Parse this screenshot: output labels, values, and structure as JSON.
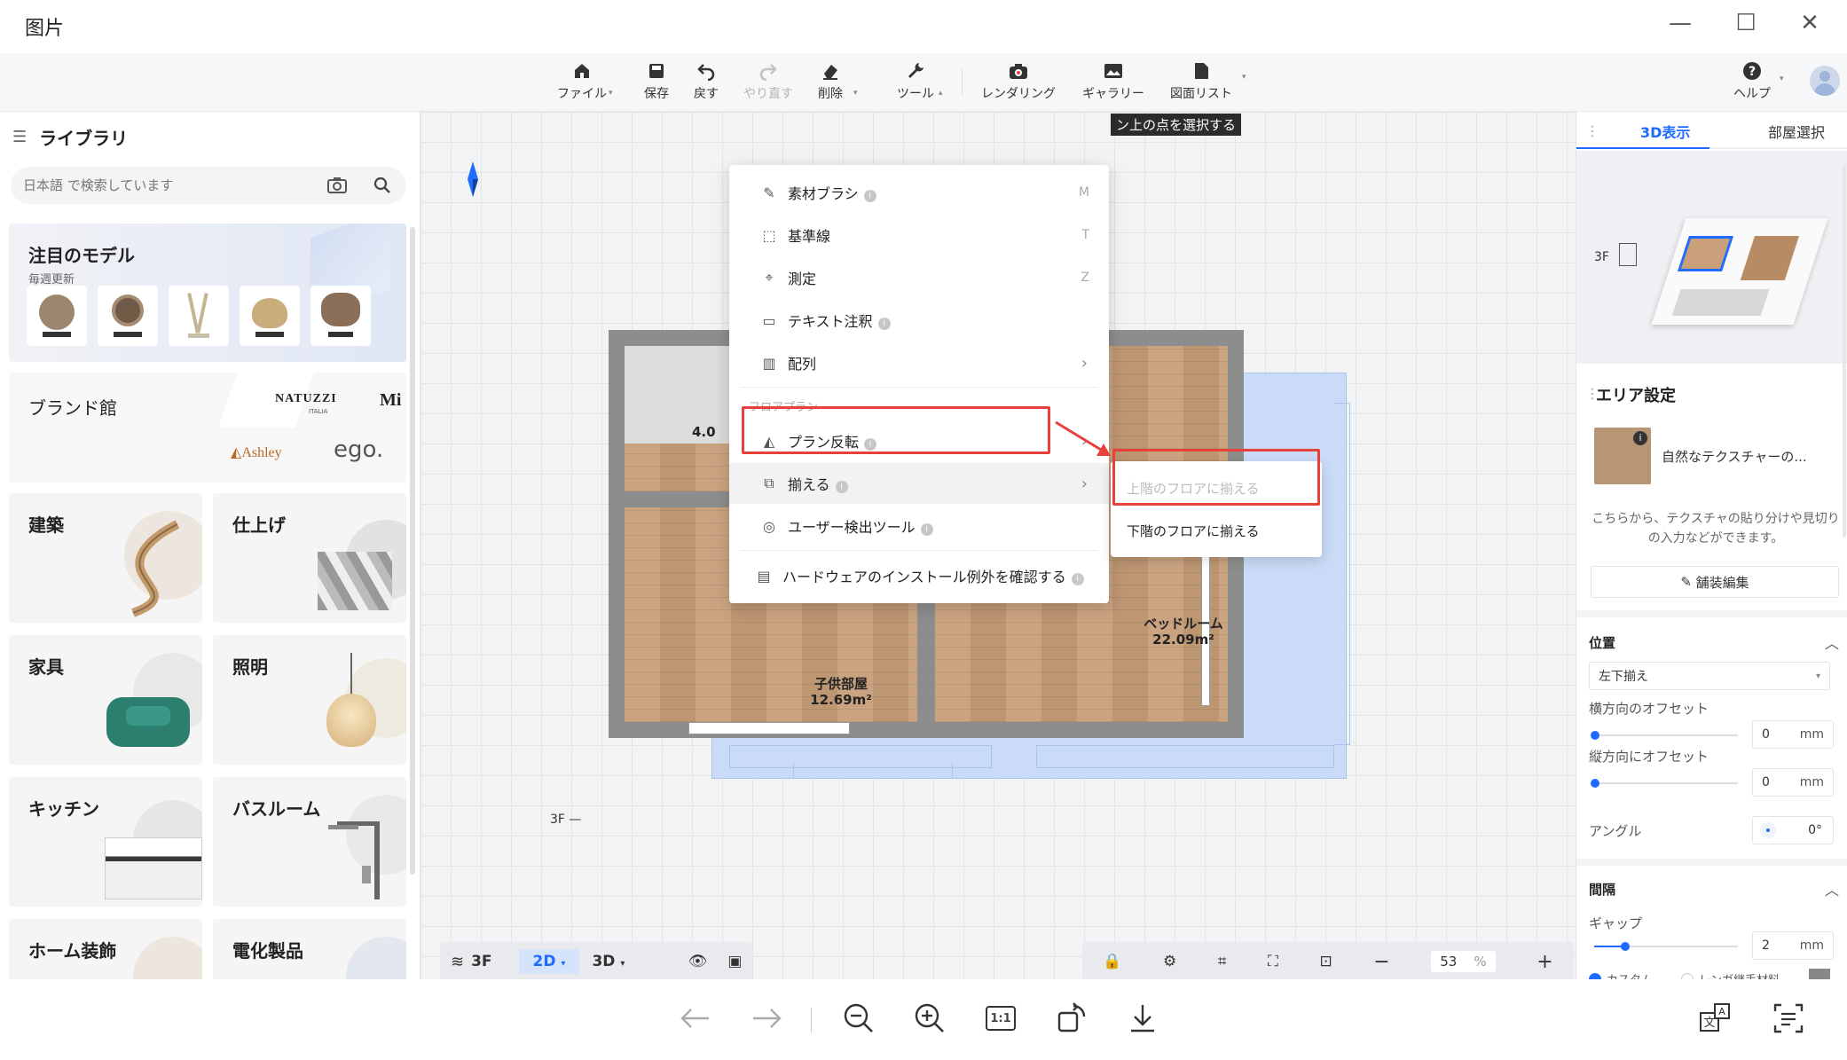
{
  "viewer": {
    "title": "图片",
    "window_buttons": {
      "minimize": "—",
      "maximize": "☐",
      "close": "✕"
    },
    "bottom_icons": [
      "arrow-left-icon",
      "arrow-right-icon",
      "zoom-out-icon",
      "zoom-in-icon",
      "actual-size-icon",
      "rotate-icon",
      "download-icon",
      "translate-icon",
      "ocr-text-icon"
    ],
    "actual_size_label": "1:1"
  },
  "toolbar": {
    "items": [
      {
        "label": "ファイル",
        "icon": "house-file-icon"
      },
      {
        "label": "保存",
        "icon": "save-icon"
      },
      {
        "label": "戻す",
        "icon": "undo-icon"
      },
      {
        "label": "やり直す",
        "icon": "redo-icon",
        "disabled": true
      },
      {
        "label": "削除",
        "icon": "eraser-icon"
      },
      {
        "label": "ツール",
        "icon": "wrench-icon"
      },
      {
        "label": "レンダリング",
        "icon": "camera-icon"
      },
      {
        "label": "ギャラリー",
        "icon": "gallery-icon"
      },
      {
        "label": "図面リスト",
        "icon": "document-icon"
      },
      {
        "label": "ヘルプ",
        "icon": "help-icon"
      }
    ]
  },
  "library": {
    "title": "ライブラリ",
    "search_placeholder": "日本語 で検索しています",
    "featured": {
      "title": "注目のモデル",
      "subtitle": "毎週更新"
    },
    "brand": {
      "title": "ブランド館",
      "brands": [
        "NATUZZI",
        "ITALIA",
        "Mi",
        "Ashley",
        "ego."
      ]
    },
    "categories": [
      "建築",
      "仕上げ",
      "家具",
      "照明",
      "キッチン",
      "バスルーム",
      "ホーム装飾",
      "電化製品"
    ]
  },
  "canvas": {
    "tooltip": "ン上の点を選択する",
    "rooms": [
      {
        "name": "子供部屋",
        "area": "12.69m²"
      },
      {
        "name": "ベッドルーム",
        "area": "22.09m²"
      }
    ],
    "partial_label": "4.0",
    "floor_marker": "3F —",
    "bottom_bar": {
      "floor": "3F",
      "view_2d": "2D",
      "view_3d": "3D",
      "zoom_value": "53",
      "zoom_unit": "%"
    }
  },
  "tool_menu": {
    "items": [
      {
        "label": "素材ブラシ",
        "key": "M",
        "icon": "brush-icon",
        "info": true
      },
      {
        "label": "基準線",
        "key": "T",
        "icon": "guideline-icon"
      },
      {
        "label": "測定",
        "key": "Z",
        "icon": "measure-icon"
      },
      {
        "label": "テキスト注釈",
        "icon": "text-note-icon",
        "info": true
      },
      {
        "label": "配列",
        "icon": "array-icon",
        "submenu": true
      }
    ],
    "floorplan_header": "フロアプラン",
    "floorplan_items": [
      {
        "label": "プラン反転",
        "icon": "flip-icon",
        "info": true,
        "submenu": true
      },
      {
        "label": "揃える",
        "icon": "align-icon",
        "info": true,
        "submenu": true
      },
      {
        "label": "ユーザー検出ツール",
        "icon": "user-detect-icon",
        "info": true
      }
    ],
    "footer_item": {
      "label": "ハードウェアのインストール例外を確認する",
      "icon": "hardware-icon",
      "info": true
    },
    "submenu": {
      "items": [
        "上階のフロアに揃える",
        "下階のフロアに揃える"
      ]
    }
  },
  "right_panel": {
    "tabs": [
      "3D表示",
      "部屋選択"
    ],
    "floor_label": "3F",
    "area_settings_title": "エリア設定",
    "texture_name": "自然なテクスチャーの...",
    "texture_hint": "こちらから、テクスチャの貼り分けや見切りの入力などができます。",
    "edit_button": "舗装編集",
    "position_title": "位置",
    "align_select": "左下揃え",
    "h_offset_label": "横方向のオフセット",
    "h_offset_value": "0",
    "v_offset_label": "縦方向にオフセット",
    "v_offset_value": "0",
    "unit_mm": "mm",
    "angle_label": "アングル",
    "angle_value": "0°",
    "spacing_title": "間隔",
    "gap_label": "ギャップ",
    "gap_value": "2",
    "custom_label": "カスタム",
    "inherit_label": "レンガ継手材料"
  },
  "colors": {
    "accent_blue": "#1f6bff",
    "highlight_red": "#e8413b",
    "wood_floor": "#c79e78",
    "plan_blue": "#c9dbf6"
  }
}
